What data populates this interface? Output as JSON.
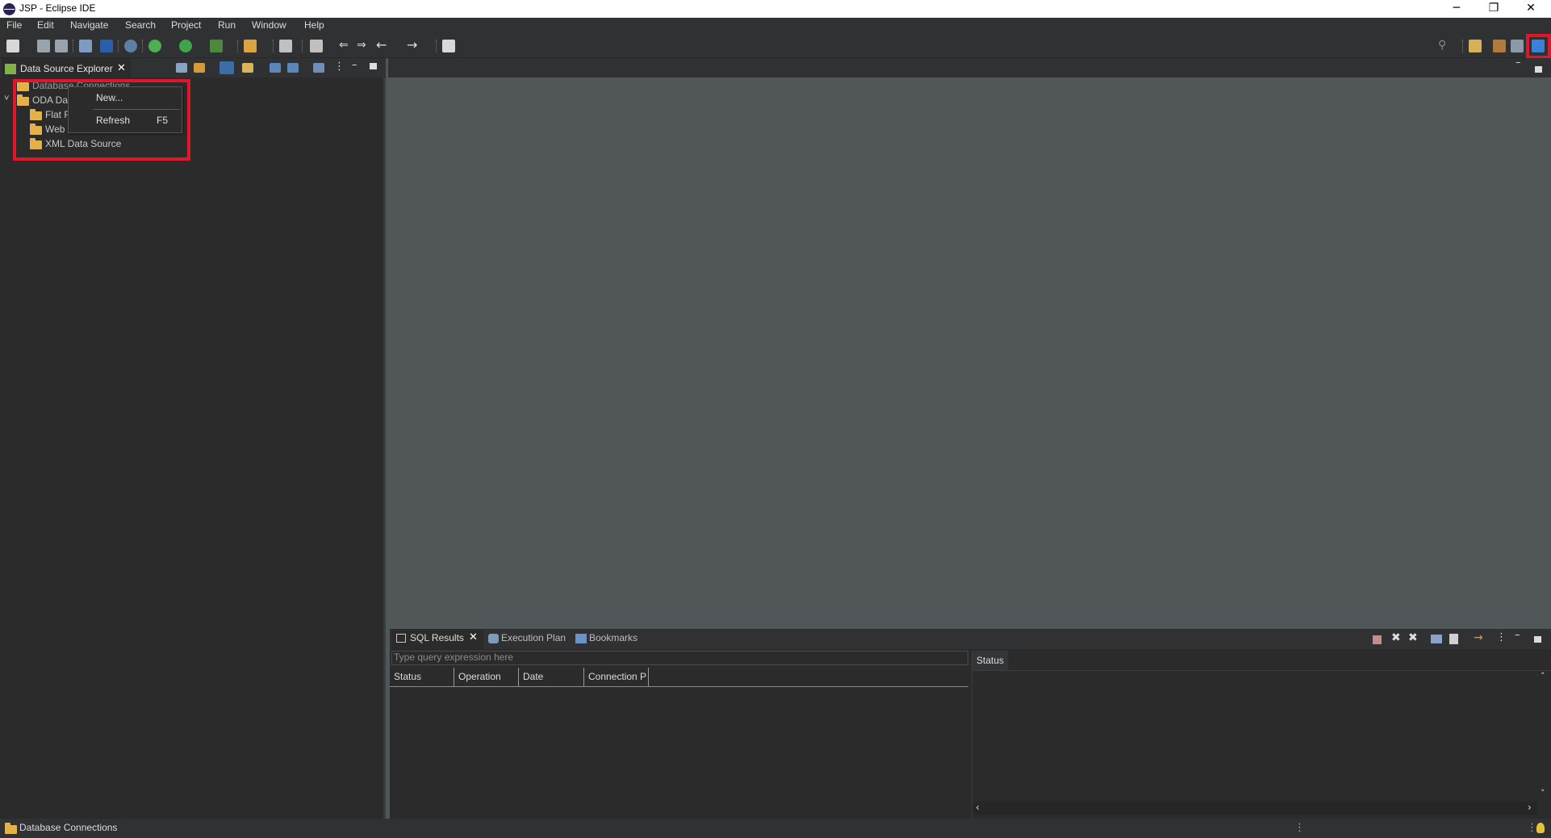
{
  "window": {
    "title": "JSP - Eclipse IDE",
    "minimize_glyph": "─",
    "restore_glyph": "❐",
    "close_glyph": "✕"
  },
  "menu": [
    "File",
    "Edit",
    "Navigate",
    "Search",
    "Project",
    "Run",
    "Window",
    "Help"
  ],
  "data_source_explorer": {
    "tab_label": "Data Source Explorer",
    "tree": [
      {
        "label": "Database Connections",
        "depth": 0
      },
      {
        "label": "ODA Da",
        "depth": 0,
        "expanded": true
      },
      {
        "label": "Flat F",
        "depth": 1
      },
      {
        "label": "Web",
        "depth": 1
      },
      {
        "label": "XML Data Source",
        "depth": 1
      }
    ]
  },
  "context_menu": {
    "items": [
      {
        "label": "New...",
        "shortcut": ""
      },
      {
        "label": "Refresh",
        "shortcut": "F5"
      }
    ]
  },
  "sql_results": {
    "tabs": [
      {
        "label": "SQL Results",
        "icon": "table-icon",
        "closable": true
      },
      {
        "label": "Execution Plan",
        "icon": "plan-icon"
      },
      {
        "label": "Bookmarks",
        "icon": "bookmarks-icon"
      }
    ],
    "query_placeholder": "Type query expression here",
    "columns": [
      "Status",
      "Operation",
      "Date",
      "Connection P"
    ],
    "status_tab": "Status"
  },
  "statusbar": {
    "text": "Database Connections"
  },
  "colors": {
    "highlight_box": "#e0162b",
    "folder": "#e3b14a",
    "editor_bg": "#515658",
    "panel_bg": "#2b2b2b"
  }
}
